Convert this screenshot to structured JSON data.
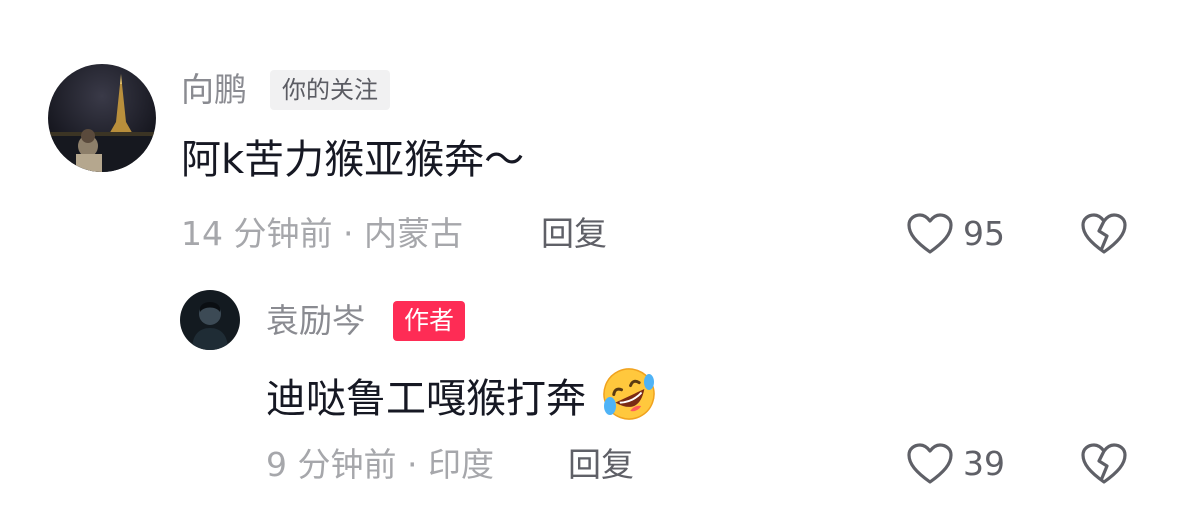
{
  "comments": [
    {
      "username": "向鹏",
      "badge": "你的关注",
      "text": "阿k苦力猴亚猴奔～",
      "meta": "14 分钟前 · 内蒙古",
      "reply_label": "回复",
      "likes": "95",
      "avatar_icon": "eiffel-tower-night-photo"
    }
  ],
  "replies": [
    {
      "username": "袁励岑",
      "badge": "作者",
      "text": "迪哒鲁工嘎猴打奔",
      "emoji": "rolling-on-floor-laughing-emoji",
      "meta": "9 分钟前 · 印度",
      "reply_label": "回复",
      "likes": "39",
      "avatar_icon": "dark-portrait-photo"
    }
  ],
  "colors": {
    "author_badge": "#fe2c55",
    "follow_badge_bg": "#f1f1f2",
    "meta_text": "#a6a7ab",
    "username_text": "#8a8b91"
  }
}
